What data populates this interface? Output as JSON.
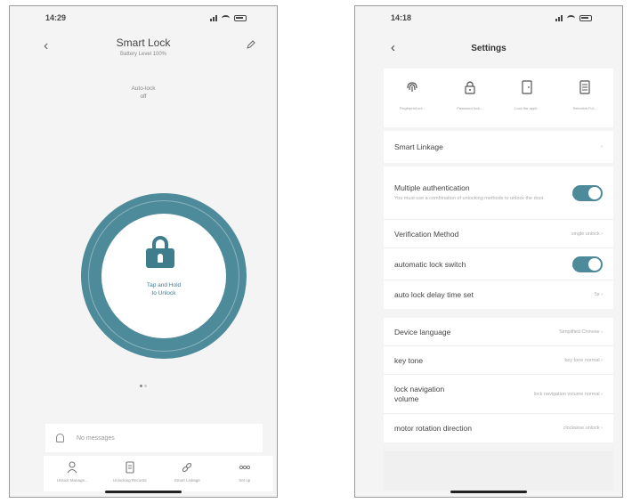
{
  "colors": {
    "accent": "#4e8b9a",
    "lock_icon": "#3f7d8d",
    "background": "#f4f4f4"
  },
  "left": {
    "status_time": "14:29",
    "title": "Smart Lock",
    "subtitle": "Battery Level 100%",
    "auto_lock_label": "Auto-lock",
    "auto_lock_value": "off",
    "unlock_text": "Tap and Hold\nto Unlock",
    "messages_text": "No messages",
    "tabs": [
      {
        "icon": "user-icon",
        "label": "Unlock Manage..."
      },
      {
        "icon": "records-icon",
        "label": "Unlocking Records"
      },
      {
        "icon": "link-icon",
        "label": "Smart Linkage"
      },
      {
        "icon": "more-icon",
        "label": "Set up"
      }
    ]
  },
  "right": {
    "status_time": "14:18",
    "title": "Settings",
    "features": [
      {
        "icon": "fingerprint-icon",
        "label": "Fingerprint unl..."
      },
      {
        "icon": "password-lock-icon",
        "label": "Password lock..."
      },
      {
        "icon": "door-icon",
        "label": "Lock the appli..."
      },
      {
        "icon": "document-icon",
        "label": "Selection Ful..."
      }
    ],
    "smart_linkage": "Smart Linkage",
    "multiple_auth_label": "Multiple authentication",
    "multiple_auth_desc": "You must use a combination of unlocking methods to unlock the door.",
    "verification_label": "Verification Method",
    "verification_value": "single unlock",
    "auto_lock_switch_label": "automatic lock switch",
    "auto_lock_delay_label": "auto lock delay time set",
    "auto_lock_delay_value": "5s",
    "device_language_label": "Device language",
    "device_language_value": "Simplified Chinese",
    "key_tone_label": "key tone",
    "key_tone_value": "key tone normal",
    "lock_navigation_label": "lock navigation volume",
    "lock_navigation_value": "lock navigation volume normal",
    "motor_direction_label": "motor rotation direction",
    "motor_direction_value": "clockwise unlock"
  }
}
